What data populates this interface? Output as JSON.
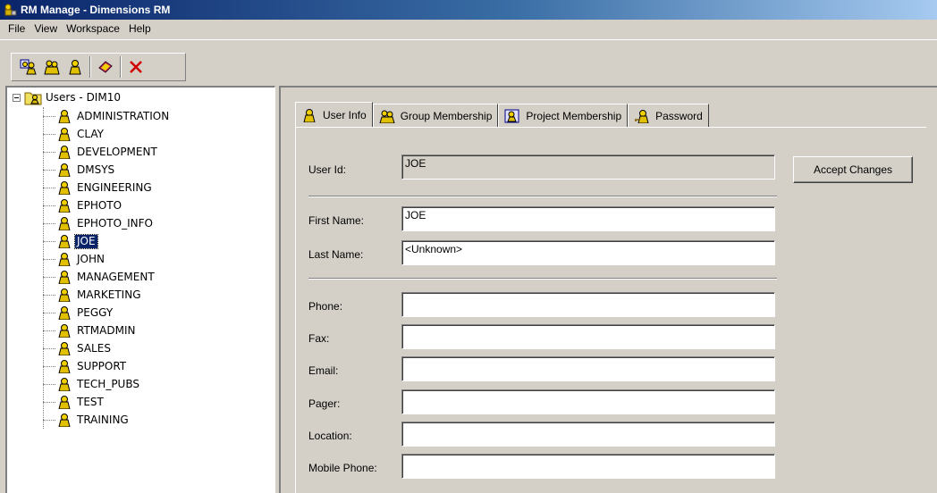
{
  "window": {
    "title": "RM Manage - Dimensions RM"
  },
  "menu": [
    "File",
    "View",
    "Workspace",
    "Help"
  ],
  "toolbar": {
    "icons": [
      "user-group-icon",
      "user-pair-icon",
      "user-icon",
      "book-icon",
      "delete-x-icon"
    ]
  },
  "tree": {
    "root_label": "Users - DIM10",
    "selected": "JOE",
    "items": [
      "ADMINISTRATION",
      "CLAY",
      "DEVELOPMENT",
      "DMSYS",
      "ENGINEERING",
      "EPHOTO",
      "EPHOTO_INFO",
      "JOE",
      "JOHN",
      "MANAGEMENT",
      "MARKETING",
      "PEGGY",
      "RTMADMIN",
      "SALES",
      "SUPPORT",
      "TECH_PUBS",
      "TEST",
      "TRAINING"
    ]
  },
  "tabs": [
    {
      "label": "User Info",
      "icon": "user-icon"
    },
    {
      "label": "Group Membership",
      "icon": "user-group-icon"
    },
    {
      "label": "Project Membership",
      "icon": "project-icon"
    },
    {
      "label": "Password",
      "icon": "key-user-icon"
    }
  ],
  "form": {
    "user_id_label": "User Id:",
    "user_id_value": "JOE",
    "accept_button": "Accept Changes",
    "first_name_label": "First Name:",
    "first_name_value": "JOE",
    "last_name_label": "Last Name:",
    "last_name_value": "<Unknown>",
    "phone_label": "Phone:",
    "phone_value": "",
    "fax_label": "Fax:",
    "fax_value": "",
    "email_label": "Email:",
    "email_value": "",
    "pager_label": "Pager:",
    "pager_value": "",
    "location_label": "Location:",
    "location_value": "",
    "mobile_label": "Mobile Phone:",
    "mobile_value": ""
  },
  "colors": {
    "titlebar": "#0a246a",
    "selection": "#0a246a",
    "face": "#d4d0c8",
    "user_icon": "#e8d000"
  }
}
